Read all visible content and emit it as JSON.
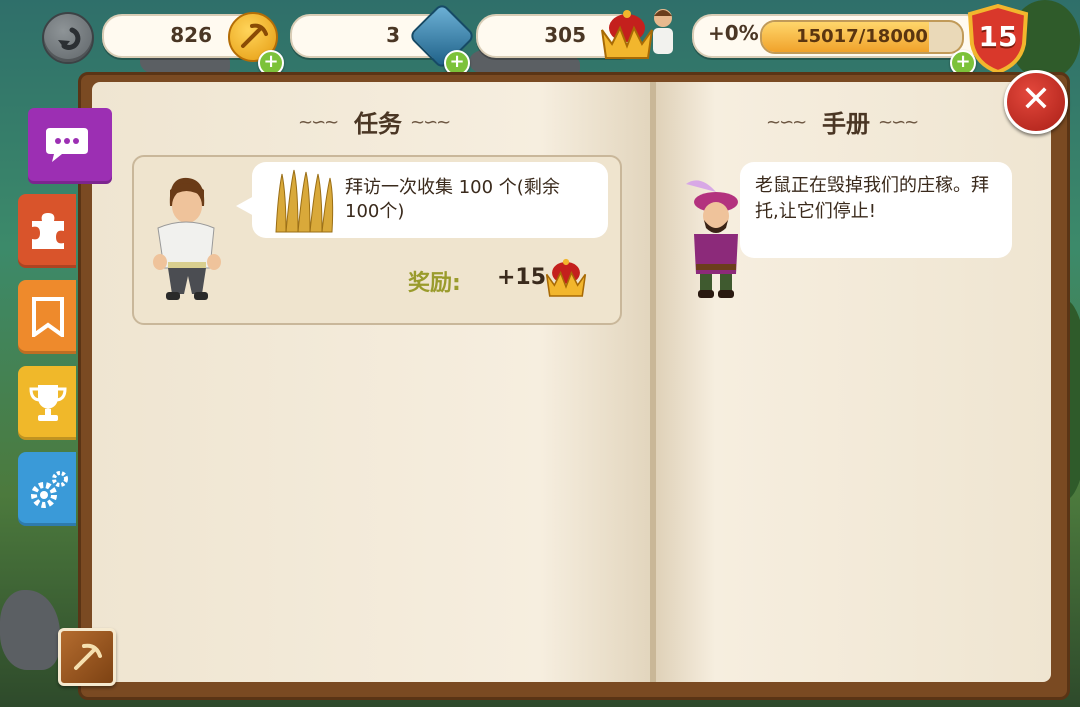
{
  "hud": {
    "coins": "826",
    "gems": "3",
    "crowns": "305",
    "xp_percent": "+0%",
    "xp_text": "15017/18000",
    "xp_progress": 0.834,
    "level": "15",
    "plus": "+"
  },
  "book": {
    "left_title": "任务",
    "right_title": "手册",
    "quest": {
      "text": "拜访一次收集 100 个(剩余 100个)",
      "reward_label": "奖励:",
      "reward_value": "+15",
      "reward_icon": "crown-icon"
    },
    "manual": {
      "text": "老鼠正在毁掉我们的庄稼。拜托,让它们停止!"
    }
  },
  "sidebar": {
    "tabs": [
      {
        "name": "chat-tab",
        "icon": "chat-bubble-icon",
        "color": "#9c2fb3"
      },
      {
        "name": "puzzle-tab",
        "icon": "puzzle-icon",
        "color": "#d9542b"
      },
      {
        "name": "bookmark-tab",
        "icon": "bookmark-icon",
        "color": "#ee8a2c"
      },
      {
        "name": "trophy-tab",
        "icon": "trophy-icon",
        "color": "#f0b82a"
      },
      {
        "name": "settings-tab",
        "icon": "gears-icon",
        "color": "#3a9ad8"
      }
    ]
  },
  "colors": {
    "page": "#f4ecdc",
    "cover": "#7a4a22",
    "accent_green": "#7cc23a",
    "close_red": "#c9302c",
    "reward_label": "#9a9b2c"
  },
  "close_symbol": "✕"
}
